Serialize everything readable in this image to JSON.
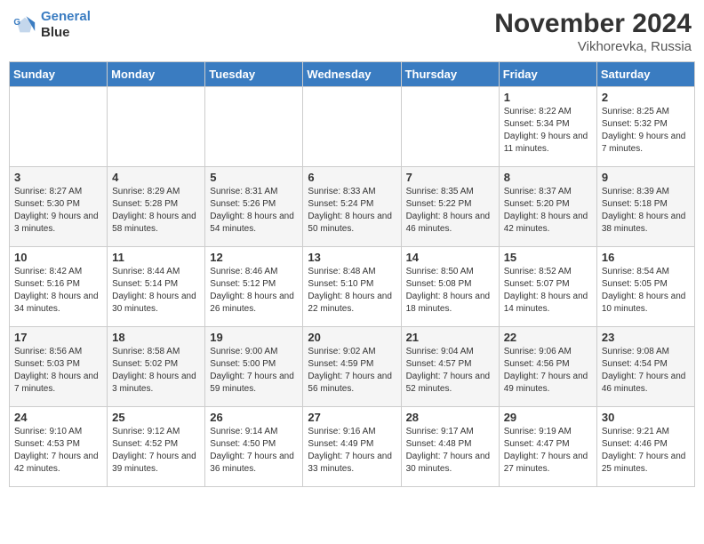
{
  "logo": {
    "line1": "General",
    "line2": "Blue"
  },
  "title": "November 2024",
  "location": "Vikhorevka, Russia",
  "days_of_week": [
    "Sunday",
    "Monday",
    "Tuesday",
    "Wednesday",
    "Thursday",
    "Friday",
    "Saturday"
  ],
  "weeks": [
    [
      null,
      null,
      null,
      null,
      null,
      {
        "day": "1",
        "sunrise": "8:22 AM",
        "sunset": "5:34 PM",
        "daylight": "9 hours and 11 minutes."
      },
      {
        "day": "2",
        "sunrise": "8:25 AM",
        "sunset": "5:32 PM",
        "daylight": "9 hours and 7 minutes."
      }
    ],
    [
      {
        "day": "3",
        "sunrise": "8:27 AM",
        "sunset": "5:30 PM",
        "daylight": "9 hours and 3 minutes."
      },
      {
        "day": "4",
        "sunrise": "8:29 AM",
        "sunset": "5:28 PM",
        "daylight": "8 hours and 58 minutes."
      },
      {
        "day": "5",
        "sunrise": "8:31 AM",
        "sunset": "5:26 PM",
        "daylight": "8 hours and 54 minutes."
      },
      {
        "day": "6",
        "sunrise": "8:33 AM",
        "sunset": "5:24 PM",
        "daylight": "8 hours and 50 minutes."
      },
      {
        "day": "7",
        "sunrise": "8:35 AM",
        "sunset": "5:22 PM",
        "daylight": "8 hours and 46 minutes."
      },
      {
        "day": "8",
        "sunrise": "8:37 AM",
        "sunset": "5:20 PM",
        "daylight": "8 hours and 42 minutes."
      },
      {
        "day": "9",
        "sunrise": "8:39 AM",
        "sunset": "5:18 PM",
        "daylight": "8 hours and 38 minutes."
      }
    ],
    [
      {
        "day": "10",
        "sunrise": "8:42 AM",
        "sunset": "5:16 PM",
        "daylight": "8 hours and 34 minutes."
      },
      {
        "day": "11",
        "sunrise": "8:44 AM",
        "sunset": "5:14 PM",
        "daylight": "8 hours and 30 minutes."
      },
      {
        "day": "12",
        "sunrise": "8:46 AM",
        "sunset": "5:12 PM",
        "daylight": "8 hours and 26 minutes."
      },
      {
        "day": "13",
        "sunrise": "8:48 AM",
        "sunset": "5:10 PM",
        "daylight": "8 hours and 22 minutes."
      },
      {
        "day": "14",
        "sunrise": "8:50 AM",
        "sunset": "5:08 PM",
        "daylight": "8 hours and 18 minutes."
      },
      {
        "day": "15",
        "sunrise": "8:52 AM",
        "sunset": "5:07 PM",
        "daylight": "8 hours and 14 minutes."
      },
      {
        "day": "16",
        "sunrise": "8:54 AM",
        "sunset": "5:05 PM",
        "daylight": "8 hours and 10 minutes."
      }
    ],
    [
      {
        "day": "17",
        "sunrise": "8:56 AM",
        "sunset": "5:03 PM",
        "daylight": "8 hours and 7 minutes."
      },
      {
        "day": "18",
        "sunrise": "8:58 AM",
        "sunset": "5:02 PM",
        "daylight": "8 hours and 3 minutes."
      },
      {
        "day": "19",
        "sunrise": "9:00 AM",
        "sunset": "5:00 PM",
        "daylight": "7 hours and 59 minutes."
      },
      {
        "day": "20",
        "sunrise": "9:02 AM",
        "sunset": "4:59 PM",
        "daylight": "7 hours and 56 minutes."
      },
      {
        "day": "21",
        "sunrise": "9:04 AM",
        "sunset": "4:57 PM",
        "daylight": "7 hours and 52 minutes."
      },
      {
        "day": "22",
        "sunrise": "9:06 AM",
        "sunset": "4:56 PM",
        "daylight": "7 hours and 49 minutes."
      },
      {
        "day": "23",
        "sunrise": "9:08 AM",
        "sunset": "4:54 PM",
        "daylight": "7 hours and 46 minutes."
      }
    ],
    [
      {
        "day": "24",
        "sunrise": "9:10 AM",
        "sunset": "4:53 PM",
        "daylight": "7 hours and 42 minutes."
      },
      {
        "day": "25",
        "sunrise": "9:12 AM",
        "sunset": "4:52 PM",
        "daylight": "7 hours and 39 minutes."
      },
      {
        "day": "26",
        "sunrise": "9:14 AM",
        "sunset": "4:50 PM",
        "daylight": "7 hours and 36 minutes."
      },
      {
        "day": "27",
        "sunrise": "9:16 AM",
        "sunset": "4:49 PM",
        "daylight": "7 hours and 33 minutes."
      },
      {
        "day": "28",
        "sunrise": "9:17 AM",
        "sunset": "4:48 PM",
        "daylight": "7 hours and 30 minutes."
      },
      {
        "day": "29",
        "sunrise": "9:19 AM",
        "sunset": "4:47 PM",
        "daylight": "7 hours and 27 minutes."
      },
      {
        "day": "30",
        "sunrise": "9:21 AM",
        "sunset": "4:46 PM",
        "daylight": "7 hours and 25 minutes."
      }
    ]
  ]
}
